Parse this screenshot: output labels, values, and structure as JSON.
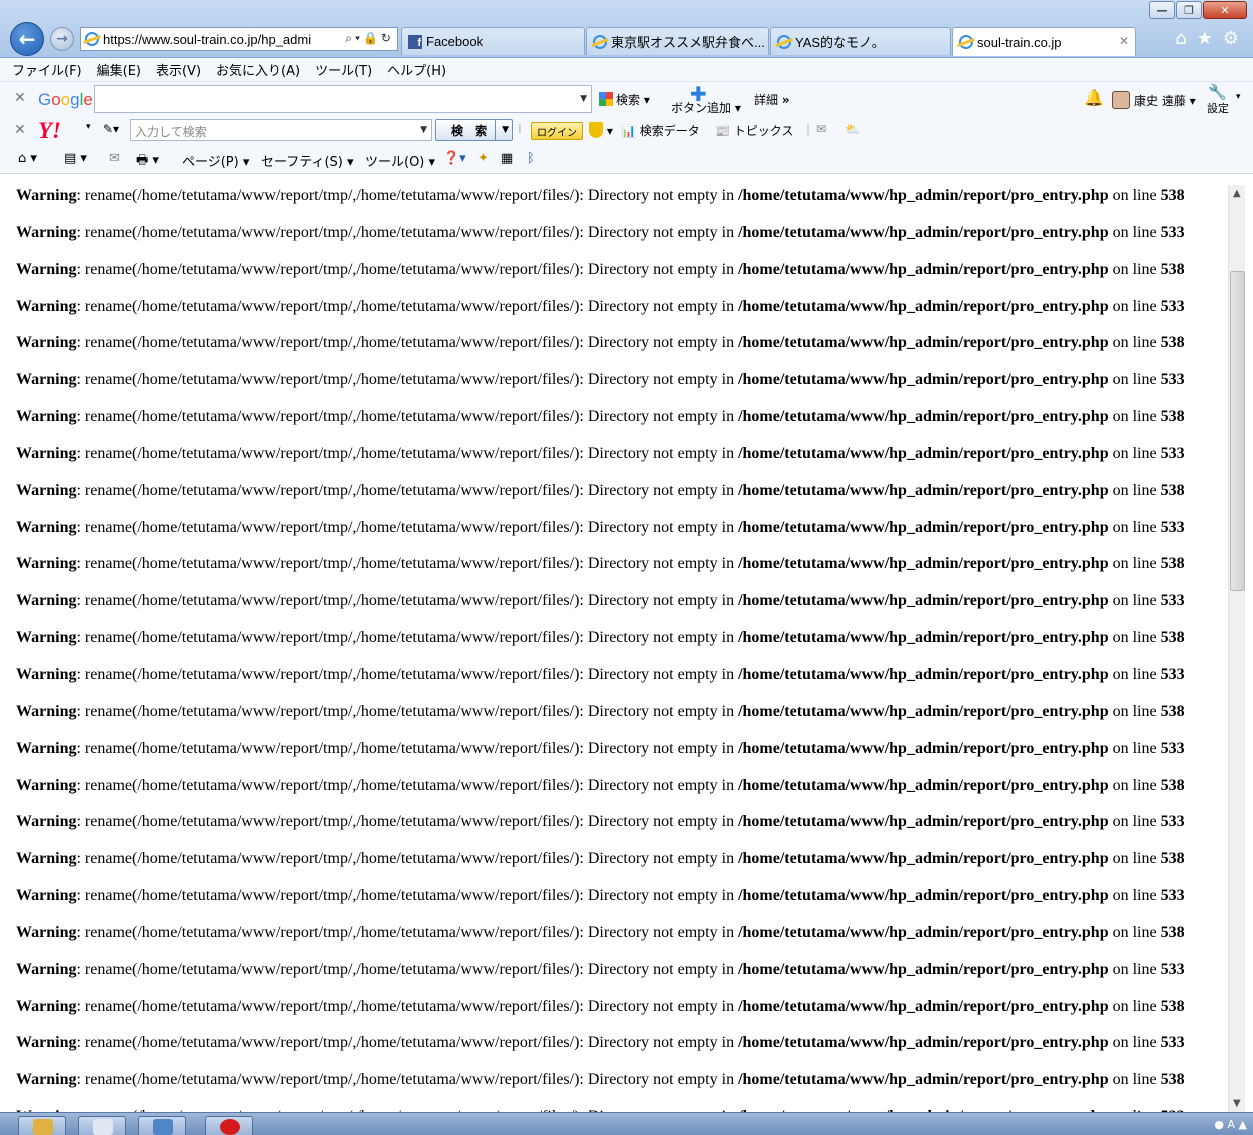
{
  "window": {
    "controls": [
      "—",
      "❐",
      "✕"
    ]
  },
  "address": {
    "url": "https://www.soul-train.co.jp/hp_admi"
  },
  "tabs": [
    {
      "label": "Facebook"
    },
    {
      "label": "東京駅オススメ駅弁食べ..."
    },
    {
      "label": "YAS的なモノ。"
    },
    {
      "label": "soul-train.co.jp"
    }
  ],
  "menu": [
    "ファイル(F)",
    "編集(E)",
    "表示(V)",
    "お気に入り(A)",
    "ツール(T)",
    "ヘルプ(H)"
  ],
  "google_toolbar": {
    "logo": [
      "G",
      "o",
      "o",
      "g",
      "l",
      "e"
    ],
    "search_label": "検索",
    "add_button_label": "ボタン追加",
    "details_label": "詳細",
    "user_name": "康史 遠藤",
    "settings_label": "設定"
  },
  "yahoo_toolbar": {
    "logo": "Y!",
    "search_placeholder": "入力して検索",
    "search_button": "検 索",
    "login_button": "ログイン",
    "search_data_label": "検索データ",
    "topics_label": "トピックス"
  },
  "command_bar": {
    "page_label": "ページ(P)",
    "safety_label": "セーフティ(S)",
    "tools_label": "ツール(O)"
  },
  "warning": {
    "label": "Warning",
    "message": ": rename(/home/tetutama/www/report/tmp/,/home/tetutama/www/report/files/): Directory not empty in ",
    "file": "/home/tetutama/www/hp_admin/report/pro_entry.php",
    "on_line": " on line ",
    "lines": [
      "538",
      "533",
      "538",
      "533",
      "538",
      "533",
      "538",
      "533",
      "538",
      "533",
      "538",
      "533",
      "538",
      "533",
      "538",
      "533",
      "538",
      "533",
      "538",
      "533",
      "538",
      "533",
      "538",
      "533",
      "538",
      "533"
    ]
  }
}
